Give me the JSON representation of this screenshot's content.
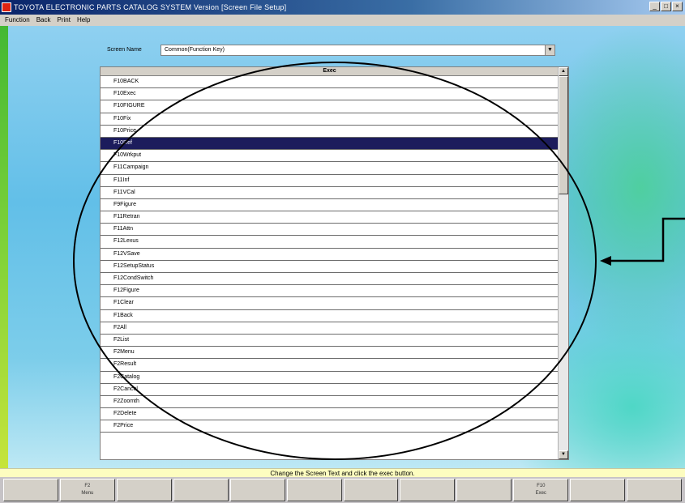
{
  "window": {
    "title": "TOYOTA ELECTRONIC PARTS CATALOG SYSTEM Version [Screen File Setup]",
    "controls": [
      "_",
      "□",
      "×"
    ]
  },
  "menu": [
    "Function",
    "Back",
    "Print",
    "Help"
  ],
  "screen": {
    "label": "Screen Name",
    "value": "Common(Function Key)",
    "arrow": "▼"
  },
  "list": {
    "header": "Exec",
    "selected_index": 5,
    "items": [
      "F10BACK",
      "F10Exec",
      "F10FIGURE",
      "F10Fix",
      "F10Price",
      "F10Ref",
      "F10Wrkput",
      "F11Campaign",
      "F11Inf",
      "F11VCal",
      "F9Figure",
      "F11Retran",
      "F11Attn",
      "F12Lexus",
      "F12VSave",
      "F12SetupStatus",
      "F12CondSwitch",
      "F12Figure",
      "F1Clear",
      "F1Back",
      "F2All",
      "F2List",
      "F2Menu",
      "F2Result",
      "F2Catalog",
      "F2Cancel",
      "F2Zoomth",
      "F2Delete",
      "F2Price"
    ],
    "scroll_up": "▲",
    "scroll_down": "▼"
  },
  "status_text": "Change the Screen Text and click the exec button.",
  "fkeys": [
    {
      "num": "",
      "label": ""
    },
    {
      "num": "F2",
      "label": "Menu"
    },
    {
      "num": "",
      "label": ""
    },
    {
      "num": "",
      "label": ""
    },
    {
      "num": "",
      "label": ""
    },
    {
      "num": "",
      "label": ""
    },
    {
      "num": "",
      "label": ""
    },
    {
      "num": "",
      "label": ""
    },
    {
      "num": "",
      "label": ""
    },
    {
      "num": "F10",
      "label": "Exec"
    },
    {
      "num": "",
      "label": ""
    },
    {
      "num": "",
      "label": ""
    }
  ]
}
